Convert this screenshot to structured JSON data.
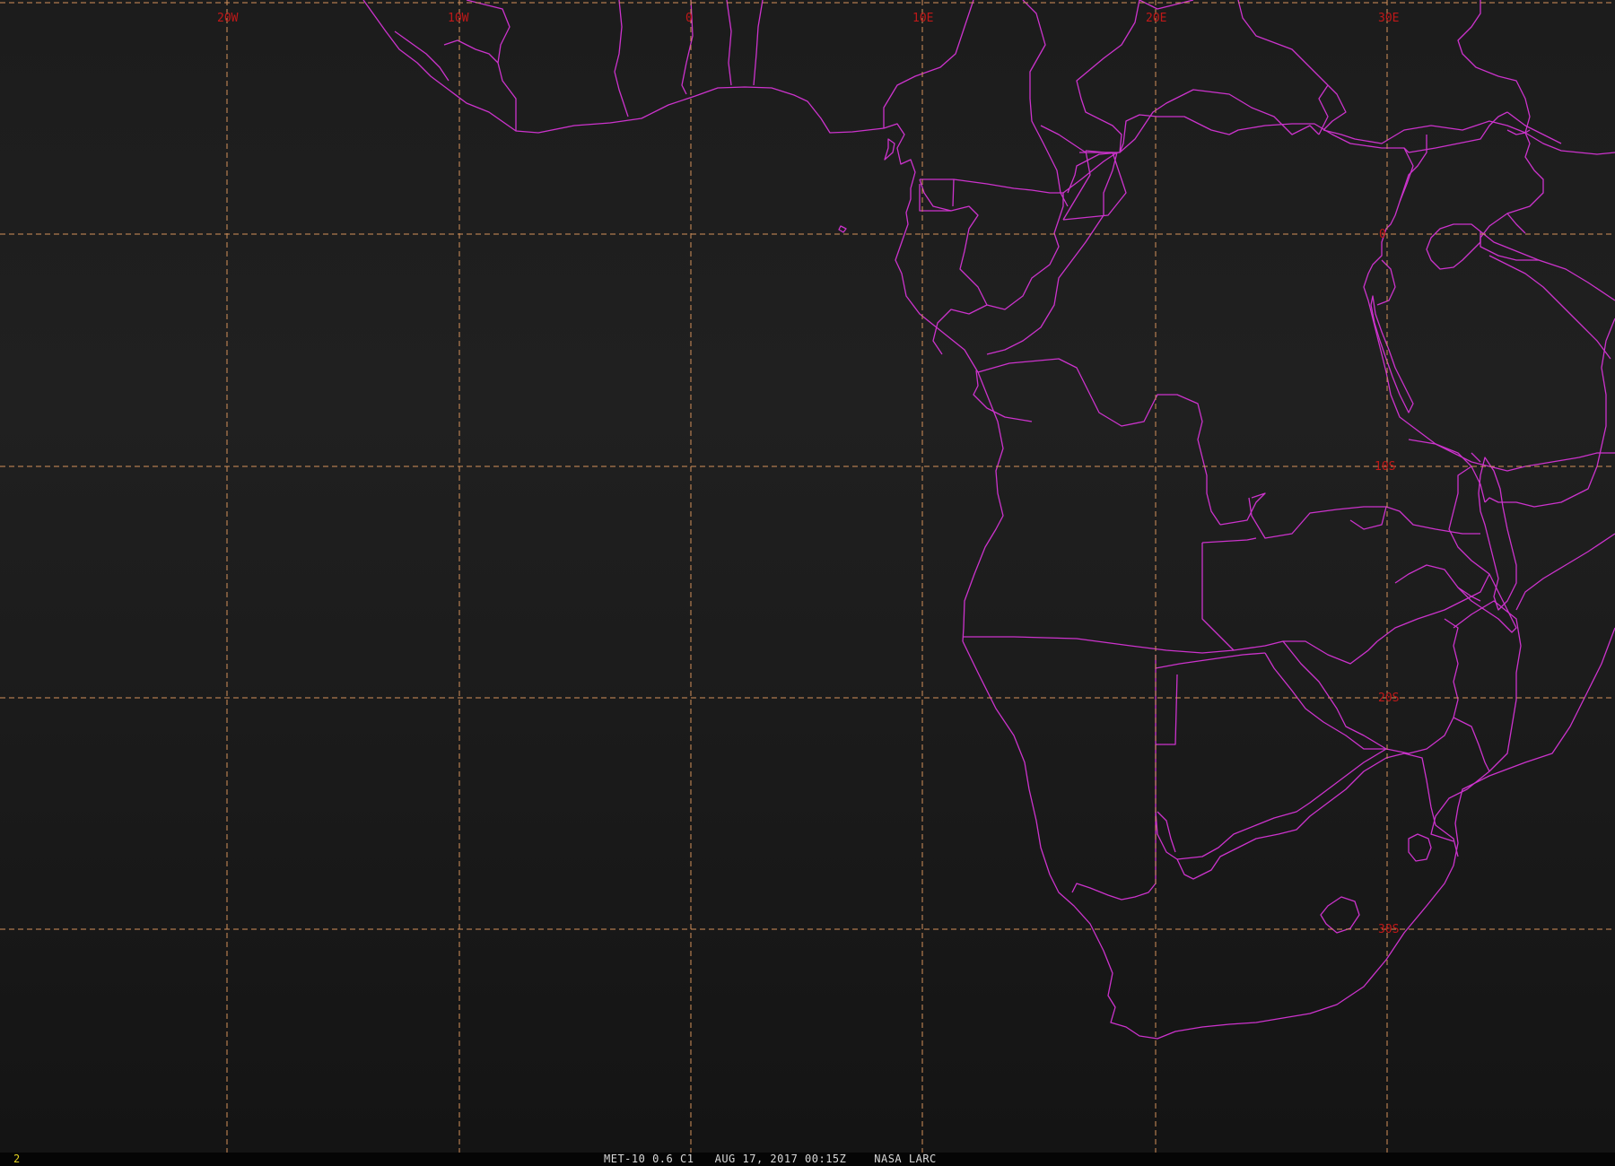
{
  "map": {
    "background_color": "#1a1a1a",
    "coastline_color": "#cc33cc",
    "grid_color": "#d4915a",
    "label_color": "#c01818",
    "longitude_labels": [
      "20W",
      "10W",
      "0",
      "10E",
      "20E",
      "30E"
    ],
    "latitude_labels": [
      "0",
      "10S",
      "20S",
      "30S"
    ]
  },
  "status_bar": {
    "frame_number": "2",
    "caption": "MET-10 0.6 C1   AUG 17, 2017 00:15Z    NASA LARC",
    "frame_color": "#e0d020",
    "caption_color": "#d8d8d8"
  }
}
